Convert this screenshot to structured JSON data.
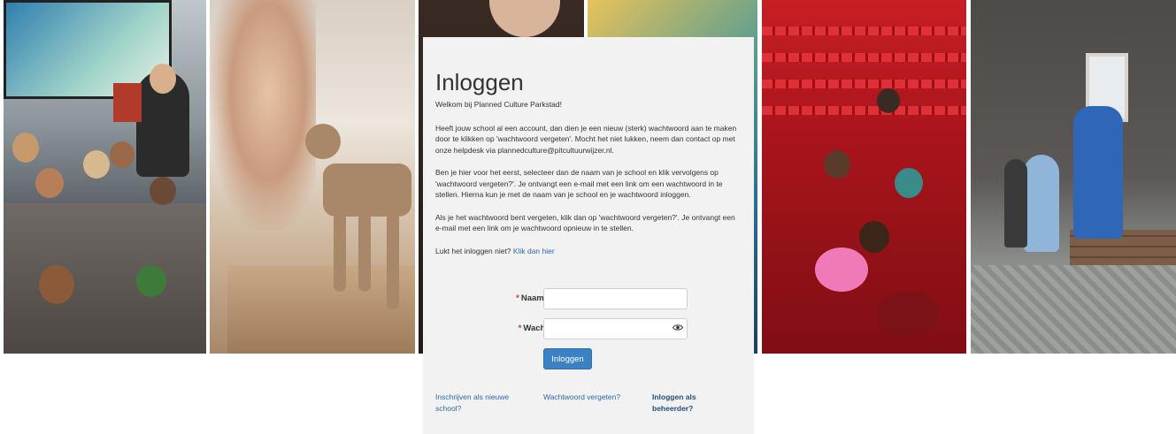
{
  "card": {
    "title": "Inloggen",
    "welcome": "Welkom bij Planned Culture Parkstad!",
    "para1": "Heeft jouw school al een account, dan dien je een nieuw (sterk) wachtwoord aan te maken door te klikken op 'wachtwoord vergeten'. Mocht het niet lukken, neem dan contact op met onze helpdesk via plannedculture@pitcultuurwijzer.nl.",
    "para2": "Ben je hier voor het eerst, selecteer dan de naam van je school en klik vervolgens op 'wachtwoord vergeten?'. Je ontvangt een e-mail met een link om een wachtwoord in te stellen. Hierna kun je met de naam van je school en je wachtwoord inloggen.",
    "para3": "Als je het wachtwoord bent vergeten, klik dan op 'wachtwoord vergeten?'. Je ontvangt een e-mail met een link om je wachtwoord opnieuw in te stellen.",
    "trouble_text": "Lukt het inloggen niet?",
    "trouble_link": "Klik dan hier"
  },
  "form": {
    "required_marker": "*",
    "school_label": "Naam school",
    "school_value": "",
    "password_label": "Wachtwoord",
    "password_value": "",
    "show_password_icon": "eye-icon",
    "submit_label": "Inloggen"
  },
  "footer": {
    "register_link": "Inschrijven als nieuwe school?",
    "forgot_link": "Wachtwoord vergeten?",
    "admin_link": "Inloggen als beheerder?"
  },
  "colors": {
    "card_background": "#f2f2f2",
    "button": "#3b82c4",
    "link": "#2a6aa8",
    "required": "#c0392b"
  }
}
